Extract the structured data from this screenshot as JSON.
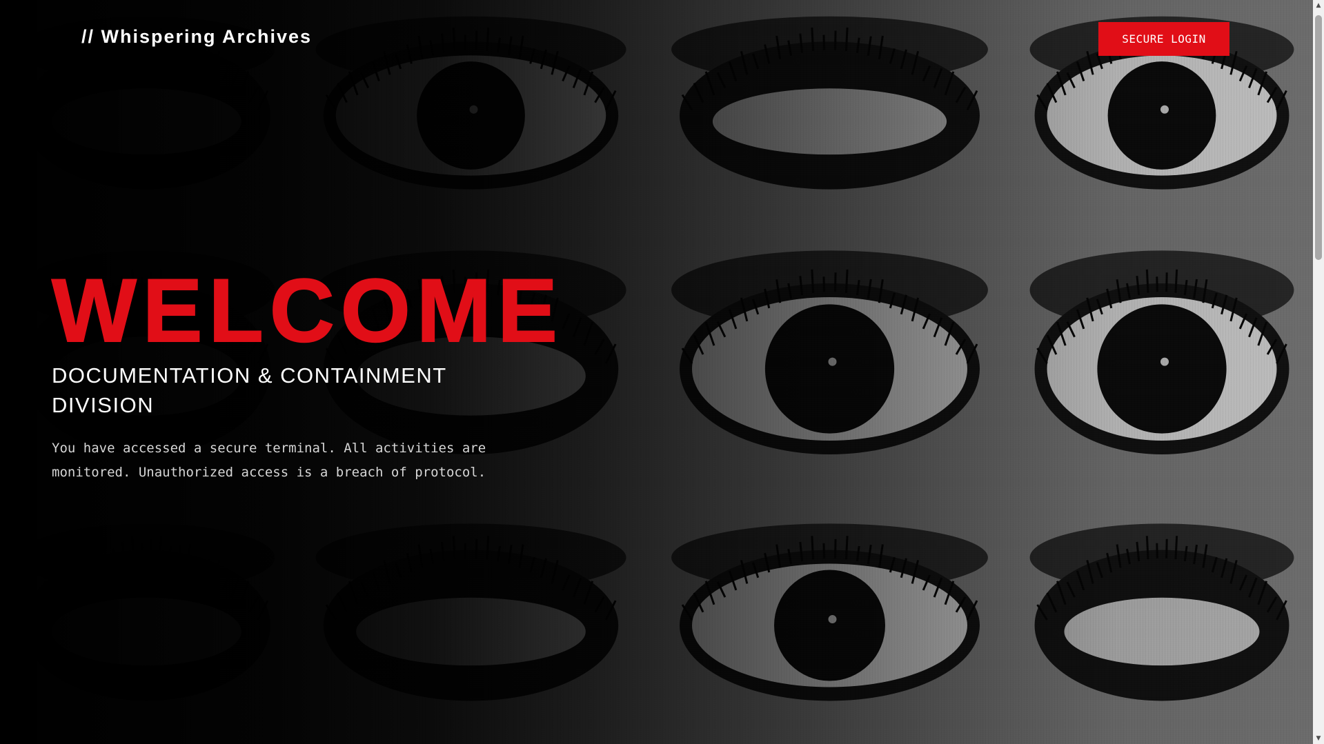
{
  "header": {
    "logo": "// Whispering Archives",
    "login_label": "SECURE LOGIN"
  },
  "hero": {
    "title": "WELCOME",
    "subtitle": "DOCUMENTATION & CONTAINMENT DIVISION",
    "body": "You have accessed a secure terminal. All activities are monitored. Unauthorized access is a breach of protocol."
  },
  "background": {
    "image": "eye-collage-icon"
  },
  "scrollbar": {
    "up_icon": "chevron-up-icon",
    "down_icon": "chevron-down-icon"
  },
  "colors": {
    "accent": "#e10e17",
    "background": "#000000",
    "text": "#ffffff"
  }
}
